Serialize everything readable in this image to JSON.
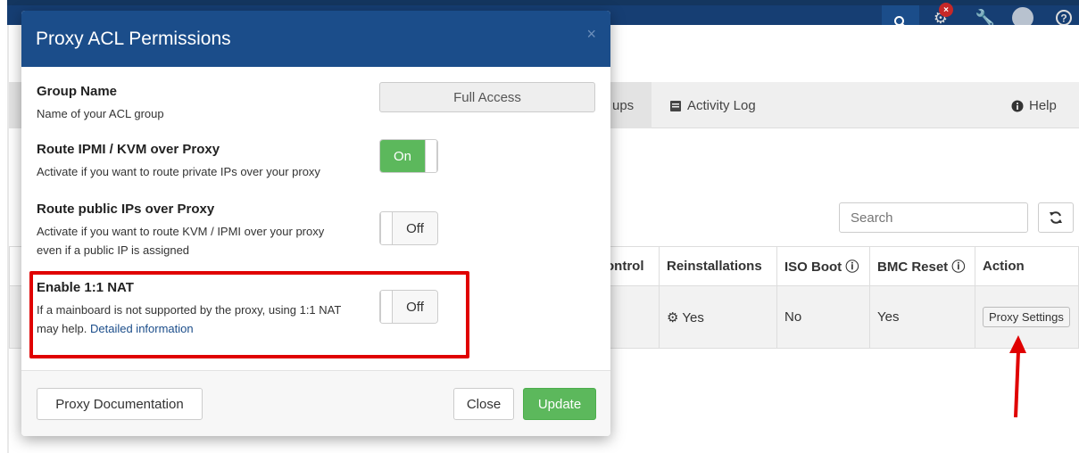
{
  "colors": {
    "header": "#1b4d8a",
    "topbar": "#163e73",
    "success": "#5cb85c",
    "highlight": "#e00000"
  },
  "background": {
    "tabs": [
      {
        "label": "ups",
        "icon": "none"
      },
      {
        "label": "Activity Log",
        "icon": "book-icon"
      },
      {
        "label": "Help",
        "icon": "info-circle-icon"
      }
    ],
    "search_placeholder": "Search",
    "table": {
      "headers": [
        "ontrol",
        "Reinstallations",
        "ISO Boot ⓘ",
        "BMC Reset ⓘ",
        "Action"
      ],
      "row": {
        "reinstallations": "Yes",
        "iso_boot": "No",
        "bmc_reset": "Yes",
        "action": "Proxy Settings"
      }
    }
  },
  "modal": {
    "title": "Proxy ACL Permissions",
    "close_glyph": "×",
    "group_name": {
      "label": "Group Name",
      "help": "Name of your ACL group",
      "value": "Full Access"
    },
    "route_ipmi": {
      "label": "Route IPMI / KVM over Proxy",
      "help": "Activate if you want to route private IPs over your proxy",
      "state": "On"
    },
    "route_public": {
      "label": "Route public IPs over Proxy",
      "help": "Activate if you want to route KVM / IPMI over your proxy even if a public IP is assigned",
      "state": "Off"
    },
    "nat": {
      "label": "Enable 1:1 NAT",
      "help": "If a mainboard is not supported by the proxy, using 1:1 NAT may help.",
      "link": "Detailed information",
      "state": "Off"
    },
    "footer": {
      "docs_button": "Proxy Documentation",
      "close_button": "Close",
      "update_button": "Update"
    }
  }
}
